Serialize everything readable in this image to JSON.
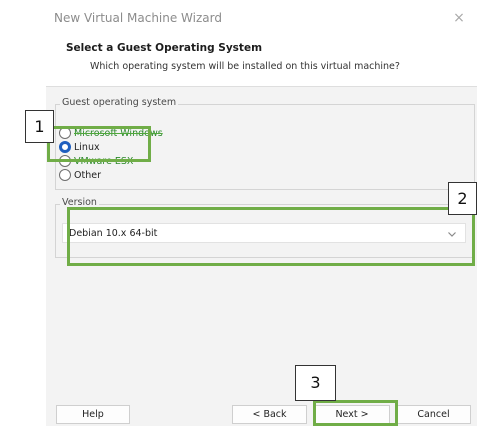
{
  "window": {
    "title": "New Virtual Machine Wizard",
    "close_symbol": "×"
  },
  "header": {
    "title": "Select a Guest Operating System",
    "subtitle": "Which operating system will be installed on this virtual machine?"
  },
  "guest_os": {
    "label": "Guest operating system",
    "options": [
      {
        "label": "Microsoft Windows",
        "selected": false
      },
      {
        "label": "Linux",
        "selected": true
      },
      {
        "label": "VMware ESX",
        "selected": false
      },
      {
        "label": "Other",
        "selected": false
      }
    ]
  },
  "version": {
    "label": "Version",
    "selected_value": "Debian 10.x 64-bit"
  },
  "buttons": {
    "help": "Help",
    "back": "< Back",
    "next": "Next >",
    "cancel": "Cancel"
  },
  "annotations": {
    "callouts": [
      "1",
      "2",
      "3"
    ],
    "highlight_color": "#70ad47"
  },
  "colors": {
    "radio_selected": "#1f5fbf",
    "dialog_background": "#f3f3f3"
  }
}
